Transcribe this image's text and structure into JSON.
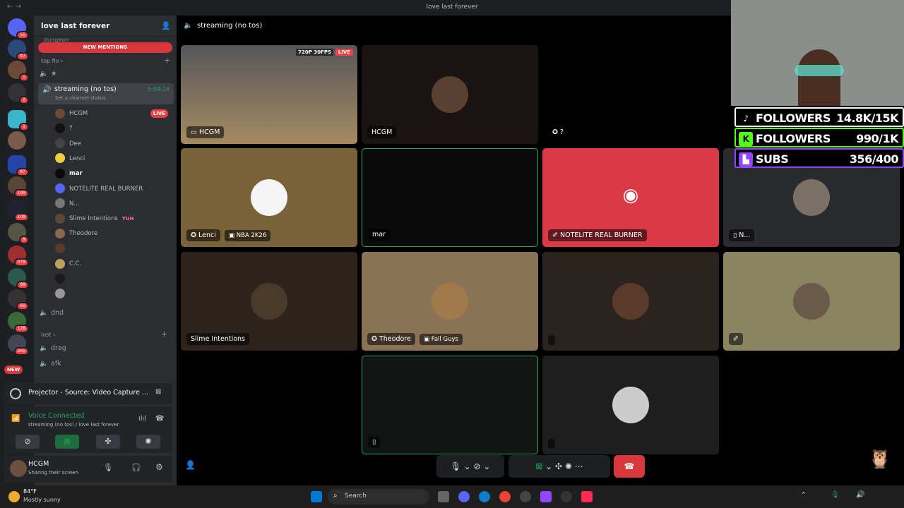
{
  "window": {
    "title": "love last forever",
    "nav": "← →"
  },
  "server": {
    "name": "love last forever",
    "new_mentions": "NEW MENTIONS",
    "partial_channel": "dungeon"
  },
  "rail": {
    "badges": [
      "55",
      "97",
      "1",
      "2",
      "1",
      "",
      "87",
      "199",
      "109",
      "9",
      "379",
      "99",
      "66",
      "128",
      "265",
      "NEW"
    ]
  },
  "sidebar": {
    "category_top": "top flo",
    "star_channel": "★",
    "active_channel": "streaming (no tos)",
    "active_timer": "5:54:14",
    "channel_status": "Set a channel status",
    "members": [
      {
        "name": "HCGM",
        "tag": "LIVE"
      },
      {
        "name": "?"
      },
      {
        "name": "Dee"
      },
      {
        "name": "Lenci"
      },
      {
        "name": "mar"
      },
      {
        "name": "NOTELITE REAL BURNER"
      },
      {
        "name": "N..."
      },
      {
        "name": "Slime Intentions",
        "tag": "YUH"
      },
      {
        "name": "Theodore"
      },
      {
        "name": ""
      },
      {
        "name": "C.C."
      },
      {
        "name": ""
      },
      {
        "name": ""
      }
    ],
    "dnd": "dnd",
    "category_lost": "lost",
    "drag": "drag",
    "afk": "afk"
  },
  "projector": {
    "title": "Projector - Source: Video Capture ..."
  },
  "voice": {
    "status": "Voice Connected",
    "detail": "streaming (no tos) / love last forever"
  },
  "user": {
    "name": "HCGM",
    "status": "Sharing their screen"
  },
  "stage": {
    "header": "streaming (no tos)",
    "tiles": [
      {
        "label": "HCGM",
        "badge": "720P 30FPS",
        "live": "LIVE"
      },
      {
        "label": "HCGM"
      },
      {
        "label": "?"
      },
      {
        "label": "Lenci",
        "game": "NBA 2K26"
      },
      {
        "label": "mar"
      },
      {
        "label": "NOTELITE REAL BURNER"
      },
      {
        "label": "N..."
      },
      {
        "label": "Slime Intentions"
      },
      {
        "label": "Theodore",
        "game": "Fall Guys"
      }
    ]
  },
  "overlay": {
    "tiktok": {
      "label": "FOLLOWERS",
      "value": "14.8K/15K"
    },
    "kick": {
      "label": "FOLLOWERS",
      "value": "990/1K"
    },
    "twitch": {
      "label": "SUBS",
      "value": "356/400"
    }
  },
  "taskbar": {
    "temp": "84°F",
    "weather": "Mostly sunny",
    "search": "Search"
  },
  "colors": {
    "discord_blurple": "#5865f2",
    "live_red": "#ed4245",
    "notelite_red": "#da3a47",
    "green": "#23a55a"
  }
}
